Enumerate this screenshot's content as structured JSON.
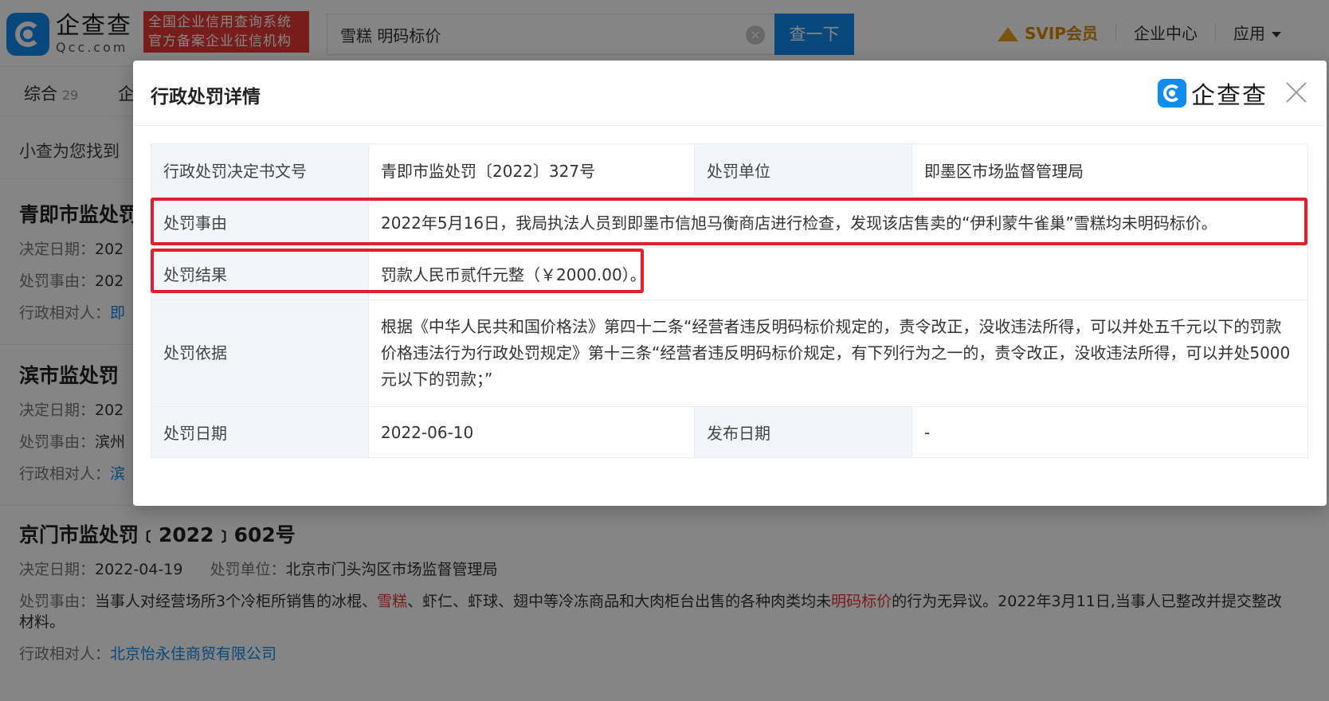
{
  "header": {
    "logo_cn": "企查查",
    "logo_en": "Qcc.com",
    "cert_line1": "全国企业信用查询系统",
    "cert_line2": "官方备案企业征信机构",
    "search_value": "雪糕 明码标价",
    "search_button": "查一下",
    "svip": "SVIP会员",
    "enterprise_center": "企业中心",
    "apps": "应用"
  },
  "tabs": [
    {
      "label": "综合",
      "count": "29"
    },
    {
      "label": "企",
      "count": ""
    }
  ],
  "results": {
    "found_text": "小查为您找到",
    "items": [
      {
        "title": "青即市监处罚",
        "date_label": "决定日期：",
        "date": "202",
        "reason_label": "处罚事由：",
        "reason": "202",
        "party_label": "行政相对人：",
        "party": "即"
      },
      {
        "title": "滨市监处罚",
        "date_label": "决定日期：",
        "date": "202",
        "reason_label": "处罚事由：",
        "reason": "滨州",
        "party_label": "行政相对人：",
        "party": "滨"
      },
      {
        "title": "京门市监处罚﹝2022﹞602号",
        "date_label": "决定日期：",
        "date": "2022-04-19",
        "unit_label": "处罚单位：",
        "unit": "北京市门头沟区市场监督管理局",
        "reason_label": "处罚事由：",
        "reason_part1": "当事人对经营场所3个冷柜所销售的冰棍、",
        "reason_hl1": "雪糕",
        "reason_part2": "、虾仁、虾球、翅中等冷冻商品和大肉柜台出售的各种肉类均未",
        "reason_hl2": "明码标价",
        "reason_part3": "的行为无异议。2022年3月11日,当事人已整改并提交整改材料。",
        "party_label": "行政相对人：",
        "party": "北京怡永佳商贸有限公司"
      }
    ]
  },
  "modal": {
    "title": "行政处罚详情",
    "logo": "企查查",
    "rows": {
      "doc_no_label": "行政处罚决定书文号",
      "doc_no": "青即市监处罚〔2022〕327号",
      "unit_label": "处罚单位",
      "unit": "即墨区市场监督管理局",
      "reason_label": "处罚事由",
      "reason": "2022年5月16日，我局执法人员到即墨市信旭马衡商店进行检查，发现该店售卖的“伊利蒙牛雀巢”雪糕均未明码标价。",
      "result_label": "处罚结果",
      "result": "罚款人民币贰仟元整（￥2000.00）。",
      "basis_label": "处罚依据",
      "basis": "根据《中华人民共和国价格法》第四十二条“经营者违反明码标价规定的，责令改正，没收违法所得，可以并处五千元以下的罚款价格违法行为行政处罚规定》第十三条“经营者违反明码标价规定，有下列行为之一的，责令改正，没收违法所得，可以并处5000元以下的罚款；”",
      "date_label": "处罚日期",
      "date": "2022-06-10",
      "publish_label": "发布日期",
      "publish": "-"
    }
  },
  "colors": {
    "brand_blue": "#128bed",
    "highlight_red": "#e0202a",
    "label_bg": "#f2f6fb"
  }
}
